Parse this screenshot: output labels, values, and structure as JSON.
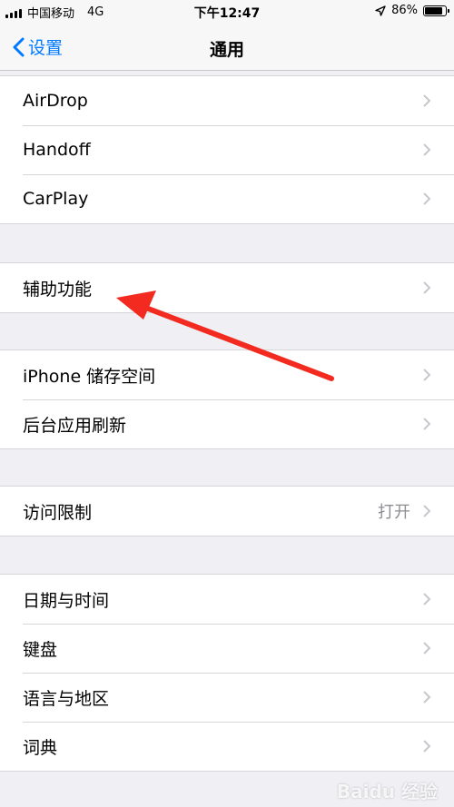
{
  "status_bar": {
    "carrier": "中国移动",
    "network": "4G",
    "time": "下午12:47",
    "battery": "86%",
    "battery_level": 0.86,
    "location_icon": "location-arrow-icon"
  },
  "nav": {
    "back_label": "设置",
    "title": "通用"
  },
  "groups": [
    {
      "rows": [
        {
          "label": "AirDrop"
        },
        {
          "label": "Handoff"
        },
        {
          "label": "CarPlay"
        }
      ]
    },
    {
      "rows": [
        {
          "label": "辅助功能"
        }
      ]
    },
    {
      "rows": [
        {
          "label": "iPhone 储存空间"
        },
        {
          "label": "后台应用刷新"
        }
      ]
    },
    {
      "rows": [
        {
          "label": "访问限制",
          "value": "打开"
        }
      ]
    },
    {
      "rows": [
        {
          "label": "日期与时间"
        },
        {
          "label": "键盘"
        },
        {
          "label": "语言与地区"
        },
        {
          "label": "词典"
        }
      ]
    }
  ],
  "watermark": "Baidu 经验",
  "colors": {
    "accent": "#007aff",
    "background": "#efeff4",
    "annotation": "#f22a1f"
  }
}
